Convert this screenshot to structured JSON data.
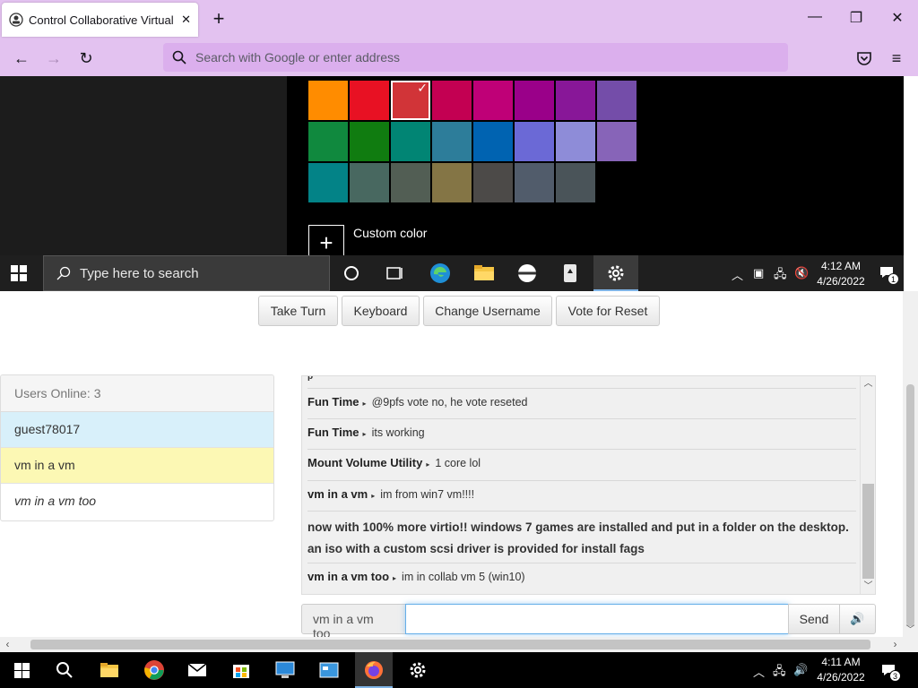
{
  "browser": {
    "tab_title": "Control Collaborative Virtual M",
    "address_placeholder": "Search with Google or enter address"
  },
  "vm": {
    "custom_color_label": "Custom color",
    "search_placeholder": "Type here to search",
    "time": "4:12 AM",
    "date": "4/26/2022",
    "notification_count": "1",
    "color_swatches": [
      [
        "#ff8c00",
        "#e81123",
        "#d13438",
        "#c30052",
        "#bf0077",
        "#9a0089",
        "#881798",
        "#744da9"
      ],
      [
        "#10893e",
        "#107c10",
        "#018574",
        "#2d7d9a",
        "#0063b1",
        "#6b69d6",
        "#8e8cd8",
        "#8764b8"
      ],
      [
        "#038387",
        "#486860",
        "#525e54",
        "#847545",
        "#4c4a48",
        "#515c6b",
        "#4a5459"
      ]
    ]
  },
  "controls": {
    "take_turn": "Take Turn",
    "keyboard": "Keyboard",
    "change_username": "Change Username",
    "vote_reset": "Vote for Reset"
  },
  "users": {
    "header": "Users Online: 3",
    "list": [
      "guest78017",
      "vm in a vm",
      "vm in a vm too"
    ]
  },
  "chat": {
    "messages": [
      {
        "user": "Fun Time",
        "text": "@9pfs vote no, he vote reseted"
      },
      {
        "user": "Fun Time",
        "text": "its working"
      },
      {
        "user": "Mount Volume Utility",
        "text": "1 core lol"
      },
      {
        "user": "vm in a vm",
        "text": "im from win7 vm!!!!"
      },
      {
        "user": "",
        "text": "now with 100% more virtio!! windows 7 games are installed and put in a folder on the desktop. an iso with a custom scsi driver is provided for install fags"
      },
      {
        "user": "vm in a vm too",
        "text": "im in collab vm 5 (win10)"
      }
    ],
    "username_addon": "vm in a vm too",
    "send_label": "Send"
  },
  "host": {
    "time": "4:11 AM",
    "date": "4/26/2022",
    "notification_count": "3"
  },
  "colors": {
    "browser_chrome": "#e3c2f0",
    "url_bar": "#dbafed",
    "user_highlight_guest": "#d8f0fa",
    "user_highlight_self": "#fcf8b4"
  }
}
